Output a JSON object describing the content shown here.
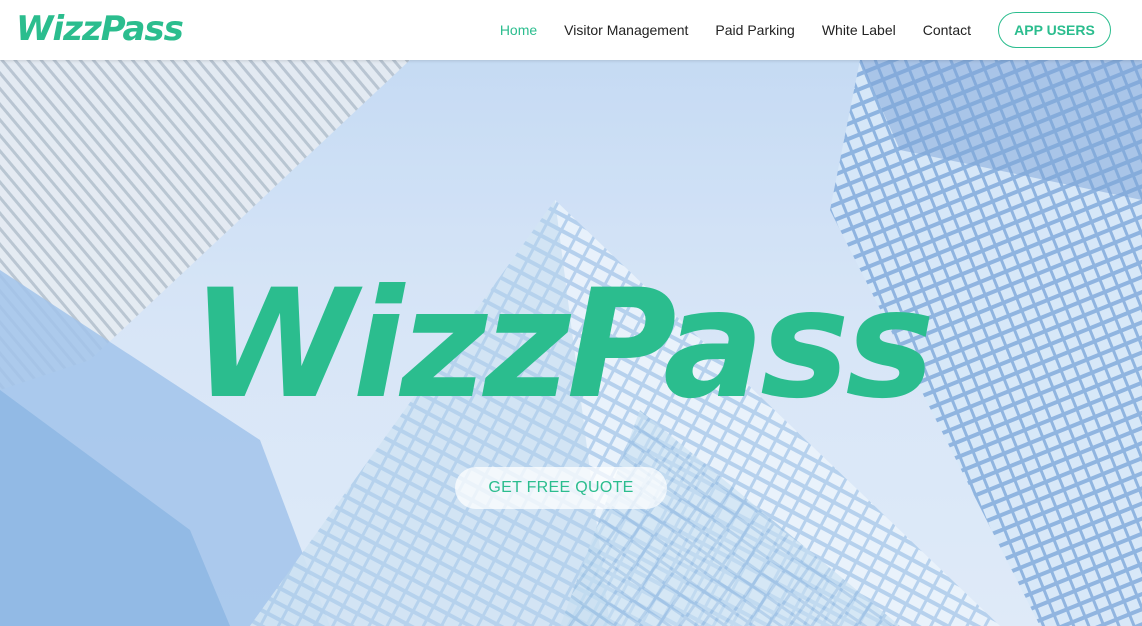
{
  "brand": {
    "logo_text": "WizzPass",
    "accent_color": "#2bbd8e"
  },
  "nav": {
    "items": [
      {
        "label": "Home",
        "active": true
      },
      {
        "label": "Visitor Management",
        "active": false
      },
      {
        "label": "Paid Parking",
        "active": false
      },
      {
        "label": "White Label",
        "active": false
      },
      {
        "label": "Contact",
        "active": false
      }
    ],
    "cta_label": "APP USERS"
  },
  "hero": {
    "title": "WizzPass",
    "button_label": "GET FREE QUOTE",
    "background_image": "glass-skyscrapers"
  }
}
